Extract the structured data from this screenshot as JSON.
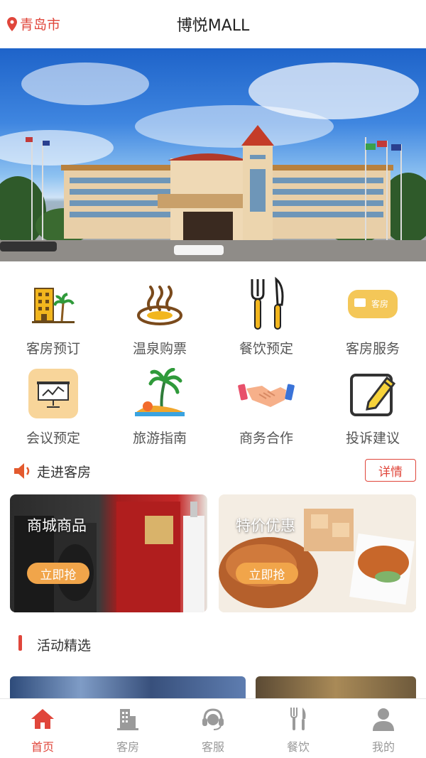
{
  "header": {
    "location": "青岛市",
    "title": "博悦MALL"
  },
  "menu": [
    {
      "label": "客房预订",
      "icon": "hotel-building-icon"
    },
    {
      "label": "温泉购票",
      "icon": "hot-spring-icon"
    },
    {
      "label": "餐饮预定",
      "icon": "fork-knife-icon"
    },
    {
      "label": "客房服务",
      "icon": "room-service-badge-icon",
      "badge": "客房"
    },
    {
      "label": "会议预定",
      "icon": "presentation-board-icon"
    },
    {
      "label": "旅游指南",
      "icon": "palm-island-icon"
    },
    {
      "label": "商务合作",
      "icon": "handshake-icon"
    },
    {
      "label": "投诉建议",
      "icon": "edit-pencil-icon"
    }
  ],
  "section_rooms": {
    "title": "走进客房",
    "more": "详情"
  },
  "promos": [
    {
      "title": "商城商品",
      "button": "立即抢"
    },
    {
      "title": "特价优惠",
      "button": "立即抢"
    }
  ],
  "section_activities": {
    "title": "活动精选"
  },
  "tabs": [
    {
      "label": "首页",
      "icon": "home-icon",
      "active": true
    },
    {
      "label": "客房",
      "icon": "building-icon",
      "active": false
    },
    {
      "label": "客服",
      "icon": "headset-icon",
      "active": false
    },
    {
      "label": "餐饮",
      "icon": "fork-knife-icon",
      "active": false
    },
    {
      "label": "我的",
      "icon": "user-icon",
      "active": false
    }
  ],
  "colors": {
    "accent": "#e0463b",
    "button": "#f1a54a",
    "inactive": "#999999"
  }
}
